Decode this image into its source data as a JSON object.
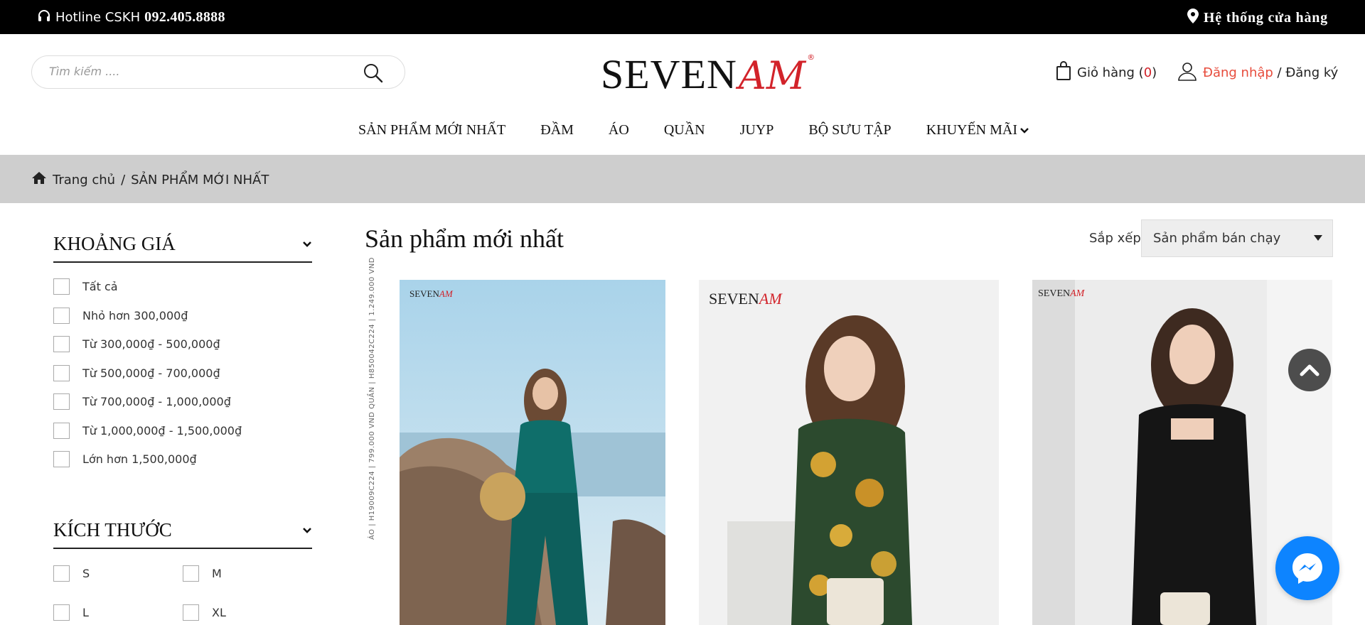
{
  "topbar": {
    "hotline_label": "Hotline CSKH",
    "hotline_number": "092.405.8888",
    "stores_label": "Hệ thống cửa hàng",
    "icons": [
      "headphones-icon",
      "map-pin-icon"
    ]
  },
  "header": {
    "search_placeholder": "Tìm kiếm ....",
    "logo_word1": "SEVEN",
    "logo_word2": "AM",
    "logo_reg": "®",
    "cart_label": "Giỏ hàng (",
    "cart_count": "0",
    "cart_close": ")",
    "login_label": "Đăng nhập",
    "account_sep": " / ",
    "register_label": "Đăng ký",
    "accent_color": "#d2232a"
  },
  "nav": {
    "items": [
      "SẢN PHẨM MỚI NHẤT",
      "ĐẦM",
      "ÁO",
      "QUẦN",
      "JUYP",
      "BỘ SƯU TẬP",
      "KHUYẾN MÃI"
    ]
  },
  "breadcrumb": {
    "home": "Trang chủ",
    "sep": "/",
    "current": "SẢN PHẨM MỚI NHẤT"
  },
  "filters": {
    "price_title": "KHOẢNG GIÁ",
    "price_options": [
      "Tất cả",
      "Nhỏ hơn 300,000₫",
      "Từ 300,000₫ - 500,000₫",
      "Từ 500,000₫ - 700,000₫",
      "Từ 700,000₫ - 1,000,000₫",
      "Từ 1,000,000₫ - 1,500,000₫",
      "Lớn hơn 1,500,000₫"
    ],
    "size_title": "KÍCH THƯỚC",
    "size_options": [
      "S",
      "M",
      "L",
      "XL"
    ]
  },
  "main": {
    "title": "Sản phẩm mới nhất",
    "sort_label": "Sắp xếp",
    "sort_value": "Sản phẩm bán chạy",
    "product1_side_text": "ÁO | H19009C224 | 799.000 VND   QUẦN | H850042C224 | 1.249.000 VND",
    "product_logo_word1": "SEVEN",
    "product_logo_word2": "AM"
  },
  "floating": {
    "icons": [
      "chevron-up-icon",
      "messenger-icon"
    ]
  }
}
